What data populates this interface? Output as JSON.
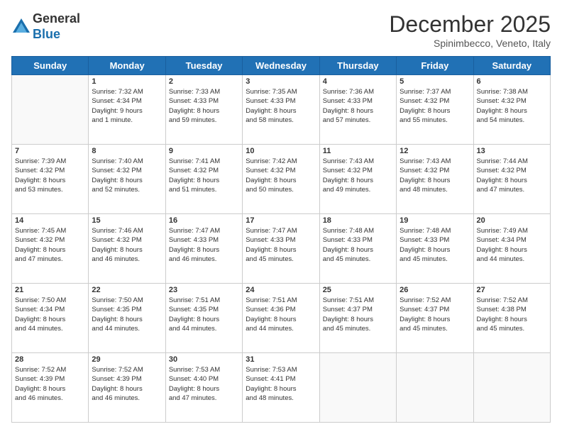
{
  "logo": {
    "general": "General",
    "blue": "Blue"
  },
  "header": {
    "month": "December 2025",
    "location": "Spinimbecco, Veneto, Italy"
  },
  "weekdays": [
    "Sunday",
    "Monday",
    "Tuesday",
    "Wednesday",
    "Thursday",
    "Friday",
    "Saturday"
  ],
  "weeks": [
    [
      {
        "day": "",
        "info": ""
      },
      {
        "day": "1",
        "info": "Sunrise: 7:32 AM\nSunset: 4:34 PM\nDaylight: 9 hours\nand 1 minute."
      },
      {
        "day": "2",
        "info": "Sunrise: 7:33 AM\nSunset: 4:33 PM\nDaylight: 8 hours\nand 59 minutes."
      },
      {
        "day": "3",
        "info": "Sunrise: 7:35 AM\nSunset: 4:33 PM\nDaylight: 8 hours\nand 58 minutes."
      },
      {
        "day": "4",
        "info": "Sunrise: 7:36 AM\nSunset: 4:33 PM\nDaylight: 8 hours\nand 57 minutes."
      },
      {
        "day": "5",
        "info": "Sunrise: 7:37 AM\nSunset: 4:32 PM\nDaylight: 8 hours\nand 55 minutes."
      },
      {
        "day": "6",
        "info": "Sunrise: 7:38 AM\nSunset: 4:32 PM\nDaylight: 8 hours\nand 54 minutes."
      }
    ],
    [
      {
        "day": "7",
        "info": "Sunrise: 7:39 AM\nSunset: 4:32 PM\nDaylight: 8 hours\nand 53 minutes."
      },
      {
        "day": "8",
        "info": "Sunrise: 7:40 AM\nSunset: 4:32 PM\nDaylight: 8 hours\nand 52 minutes."
      },
      {
        "day": "9",
        "info": "Sunrise: 7:41 AM\nSunset: 4:32 PM\nDaylight: 8 hours\nand 51 minutes."
      },
      {
        "day": "10",
        "info": "Sunrise: 7:42 AM\nSunset: 4:32 PM\nDaylight: 8 hours\nand 50 minutes."
      },
      {
        "day": "11",
        "info": "Sunrise: 7:43 AM\nSunset: 4:32 PM\nDaylight: 8 hours\nand 49 minutes."
      },
      {
        "day": "12",
        "info": "Sunrise: 7:43 AM\nSunset: 4:32 PM\nDaylight: 8 hours\nand 48 minutes."
      },
      {
        "day": "13",
        "info": "Sunrise: 7:44 AM\nSunset: 4:32 PM\nDaylight: 8 hours\nand 47 minutes."
      }
    ],
    [
      {
        "day": "14",
        "info": "Sunrise: 7:45 AM\nSunset: 4:32 PM\nDaylight: 8 hours\nand 47 minutes."
      },
      {
        "day": "15",
        "info": "Sunrise: 7:46 AM\nSunset: 4:32 PM\nDaylight: 8 hours\nand 46 minutes."
      },
      {
        "day": "16",
        "info": "Sunrise: 7:47 AM\nSunset: 4:33 PM\nDaylight: 8 hours\nand 46 minutes."
      },
      {
        "day": "17",
        "info": "Sunrise: 7:47 AM\nSunset: 4:33 PM\nDaylight: 8 hours\nand 45 minutes."
      },
      {
        "day": "18",
        "info": "Sunrise: 7:48 AM\nSunset: 4:33 PM\nDaylight: 8 hours\nand 45 minutes."
      },
      {
        "day": "19",
        "info": "Sunrise: 7:48 AM\nSunset: 4:33 PM\nDaylight: 8 hours\nand 45 minutes."
      },
      {
        "day": "20",
        "info": "Sunrise: 7:49 AM\nSunset: 4:34 PM\nDaylight: 8 hours\nand 44 minutes."
      }
    ],
    [
      {
        "day": "21",
        "info": "Sunrise: 7:50 AM\nSunset: 4:34 PM\nDaylight: 8 hours\nand 44 minutes."
      },
      {
        "day": "22",
        "info": "Sunrise: 7:50 AM\nSunset: 4:35 PM\nDaylight: 8 hours\nand 44 minutes."
      },
      {
        "day": "23",
        "info": "Sunrise: 7:51 AM\nSunset: 4:35 PM\nDaylight: 8 hours\nand 44 minutes."
      },
      {
        "day": "24",
        "info": "Sunrise: 7:51 AM\nSunset: 4:36 PM\nDaylight: 8 hours\nand 44 minutes."
      },
      {
        "day": "25",
        "info": "Sunrise: 7:51 AM\nSunset: 4:37 PM\nDaylight: 8 hours\nand 45 minutes."
      },
      {
        "day": "26",
        "info": "Sunrise: 7:52 AM\nSunset: 4:37 PM\nDaylight: 8 hours\nand 45 minutes."
      },
      {
        "day": "27",
        "info": "Sunrise: 7:52 AM\nSunset: 4:38 PM\nDaylight: 8 hours\nand 45 minutes."
      }
    ],
    [
      {
        "day": "28",
        "info": "Sunrise: 7:52 AM\nSunset: 4:39 PM\nDaylight: 8 hours\nand 46 minutes."
      },
      {
        "day": "29",
        "info": "Sunrise: 7:52 AM\nSunset: 4:39 PM\nDaylight: 8 hours\nand 46 minutes."
      },
      {
        "day": "30",
        "info": "Sunrise: 7:53 AM\nSunset: 4:40 PM\nDaylight: 8 hours\nand 47 minutes."
      },
      {
        "day": "31",
        "info": "Sunrise: 7:53 AM\nSunset: 4:41 PM\nDaylight: 8 hours\nand 48 minutes."
      },
      {
        "day": "",
        "info": ""
      },
      {
        "day": "",
        "info": ""
      },
      {
        "day": "",
        "info": ""
      }
    ]
  ]
}
